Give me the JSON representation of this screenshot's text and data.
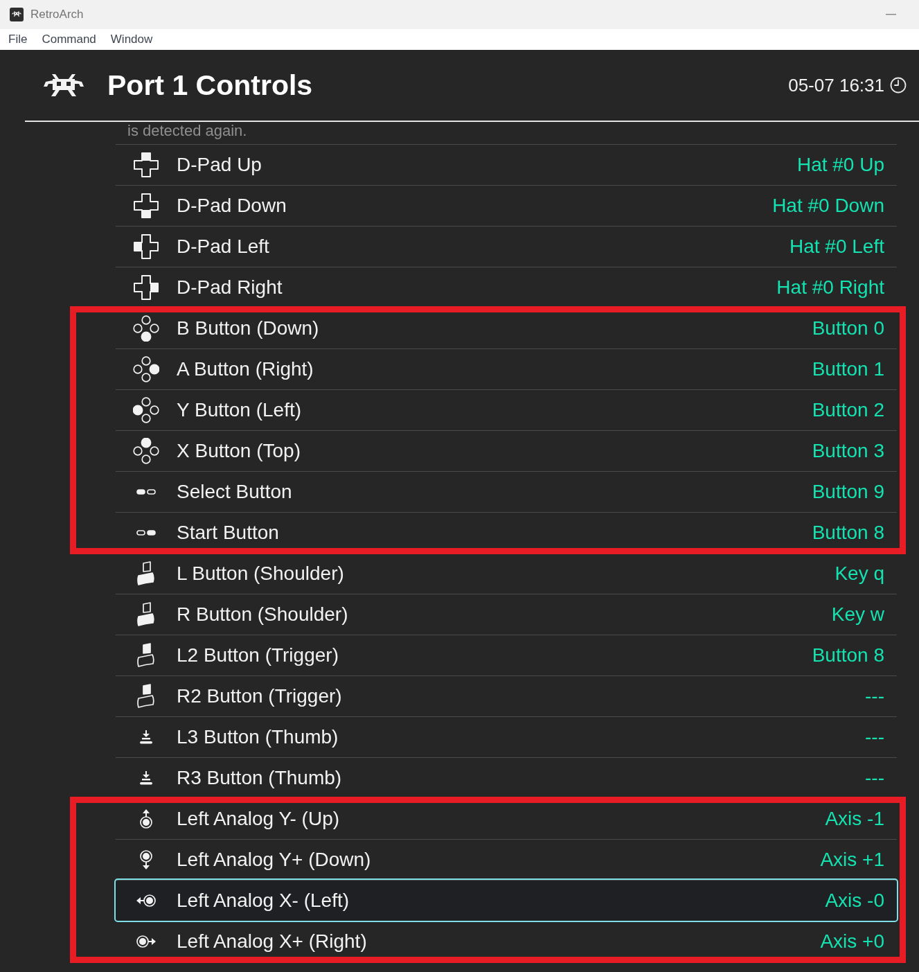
{
  "window": {
    "title": "RetroArch"
  },
  "menu_bar": [
    "File",
    "Command",
    "Window"
  ],
  "header": {
    "title": "Port 1 Controls",
    "clock": "05-07 16:31"
  },
  "notice": "is detected again.",
  "groups": [
    {
      "framed": false,
      "rows": [
        {
          "label": "D-Pad Up",
          "value": "Hat #0 Up",
          "selected": false
        },
        {
          "label": "D-Pad Down",
          "value": "Hat #0 Down",
          "selected": false
        },
        {
          "label": "D-Pad Left",
          "value": "Hat #0 Left",
          "selected": false
        },
        {
          "label": "D-Pad Right",
          "value": "Hat #0 Right",
          "selected": false
        }
      ]
    },
    {
      "framed": true,
      "rows": [
        {
          "label": "B Button (Down)",
          "value": "Button 0",
          "selected": false
        },
        {
          "label": "A Button (Right)",
          "value": "Button 1",
          "selected": false
        },
        {
          "label": "Y Button (Left)",
          "value": "Button 2",
          "selected": false
        },
        {
          "label": "X Button (Top)",
          "value": "Button 3",
          "selected": false
        },
        {
          "label": "Select Button",
          "value": "Button 9",
          "selected": false
        },
        {
          "label": "Start Button",
          "value": "Button 8",
          "selected": false
        }
      ]
    },
    {
      "framed": false,
      "rows": [
        {
          "label": "L Button (Shoulder)",
          "value": "Key q",
          "selected": false
        },
        {
          "label": "R Button (Shoulder)",
          "value": "Key w",
          "selected": false
        },
        {
          "label": "L2 Button (Trigger)",
          "value": "Button 8",
          "selected": false
        },
        {
          "label": "R2 Button (Trigger)",
          "value": "---",
          "selected": false
        },
        {
          "label": "L3 Button (Thumb)",
          "value": "---",
          "selected": false
        },
        {
          "label": "R3 Button (Thumb)",
          "value": "---",
          "selected": false
        }
      ]
    },
    {
      "framed": true,
      "rows": [
        {
          "label": "Left Analog Y- (Up)",
          "value": "Axis -1",
          "selected": false
        },
        {
          "label": "Left Analog Y+ (Down)",
          "value": "Axis +1",
          "selected": false
        },
        {
          "label": "Left Analog X- (Left)",
          "value": "Axis -0",
          "selected": true
        },
        {
          "label": "Left Analog X+ (Right)",
          "value": "Axis +0",
          "selected": false
        }
      ]
    }
  ]
}
